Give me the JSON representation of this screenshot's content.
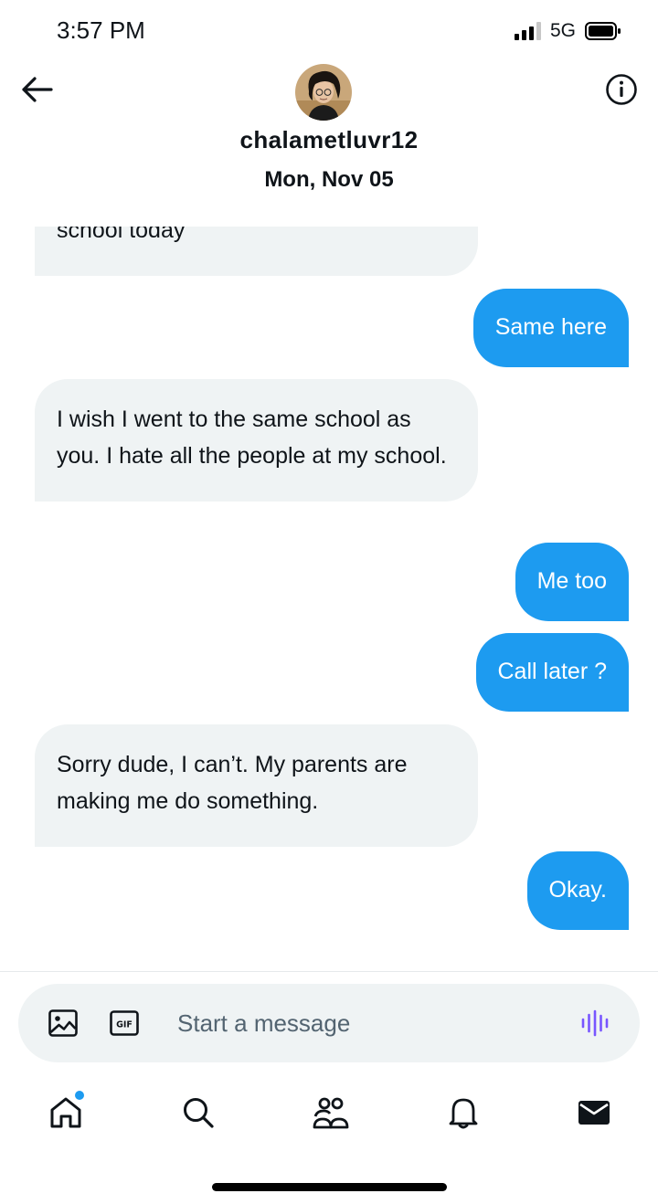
{
  "status_bar": {
    "time": "3:57 PM",
    "network": "5G"
  },
  "header": {
    "username": "chalametluvr12",
    "date": "Mon, Nov 05"
  },
  "messages": [
    {
      "direction": "received",
      "text": "school today"
    },
    {
      "direction": "sent",
      "text": "Same here"
    },
    {
      "direction": "received",
      "text": "I wish I went to the same school as you. I hate all the people at my school."
    },
    {
      "direction": "sent",
      "text": "Me too"
    },
    {
      "direction": "sent",
      "text": "Call later ?"
    },
    {
      "direction": "received",
      "text": "Sorry dude, I can’t. My parents are making me do something."
    },
    {
      "direction": "sent",
      "text": "Okay."
    }
  ],
  "composer": {
    "placeholder": "Start a message",
    "value": "",
    "gif_label": "GIF"
  },
  "nav": [
    "home-icon",
    "search-icon",
    "communities-icon",
    "notifications-icon",
    "messages-icon"
  ],
  "colors": {
    "accent": "#1d9bf0",
    "received_bubble": "#eff3f4",
    "text": "#0f1419",
    "voice_icon": "#7856ff"
  }
}
